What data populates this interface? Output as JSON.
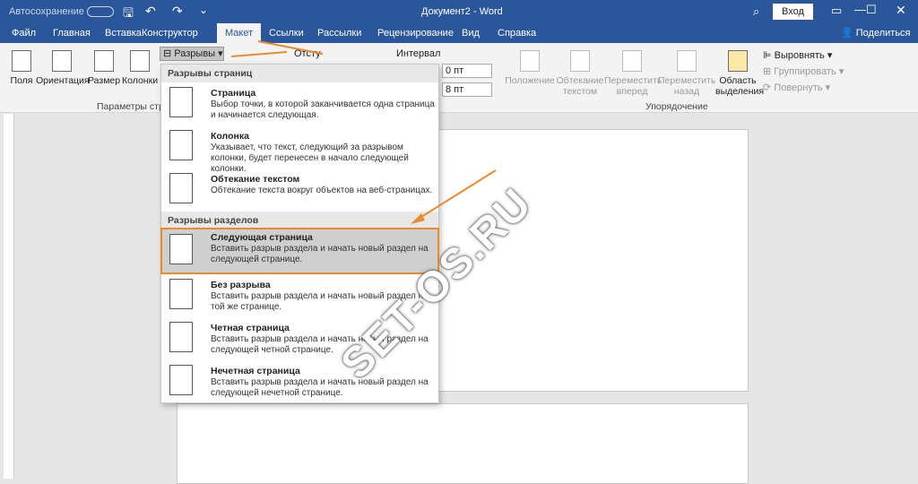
{
  "titlebar": {
    "autosave": "Автосохранение",
    "doc": "Документ2 - Word",
    "login": "Вход"
  },
  "tabs": [
    "Файл",
    "Главная",
    "Вставка",
    "Конструктор",
    "Макет",
    "Ссылки",
    "Рассылки",
    "Рецензирование",
    "Вид",
    "Справка"
  ],
  "share": "Поделиться",
  "ribbon": {
    "fields": "Поля",
    "orient": "Ориентация",
    "size": "Размер",
    "cols": "Колонки",
    "breaks": "Разрывы",
    "indent": "Отсту",
    "interval": "Интервал",
    "sp1": "0 пт",
    "sp2": "8 пт",
    "pos": "Положение",
    "wrap": "Обтекание текстом",
    "fwd": "Переместить вперед",
    "back": "Переместить назад",
    "selpane": "Область выделения",
    "align": "Выровнять",
    "group": "Группировать",
    "rotate": "Повернуть",
    "grp_page": "Параметры стра",
    "grp_arrange": "Упорядочение"
  },
  "menu": {
    "h1": "Разрывы страниц",
    "h2": "Разрывы разделов",
    "items": [
      {
        "t": "Страница",
        "d": "Выбор точки, в которой заканчивается одна страница и начинается следующая."
      },
      {
        "t": "Колонка",
        "d": "Указывает, что текст, следующий за разрывом колонки, будет перенесен в начало следующей колонки."
      },
      {
        "t": "Обтекание текстом",
        "d": "Обтекание текста вокруг объектов на веб-страницах."
      },
      {
        "t": "Следующая страница",
        "d": "Вставить разрыв раздела и начать новый раздел на следующей странице."
      },
      {
        "t": "Без разрыва",
        "d": "Вставить разрыв раздела и начать новый раздел на той же странице."
      },
      {
        "t": "Четная страница",
        "d": "Вставить разрыв раздела и начать новый раздел на следующей четной странице."
      },
      {
        "t": "Нечетная страница",
        "d": "Вставить разрыв раздела и начать новый раздел на следующей нечетной странице."
      }
    ]
  },
  "watermark": "SET-OS.RU",
  "accent": "#e88b2e"
}
